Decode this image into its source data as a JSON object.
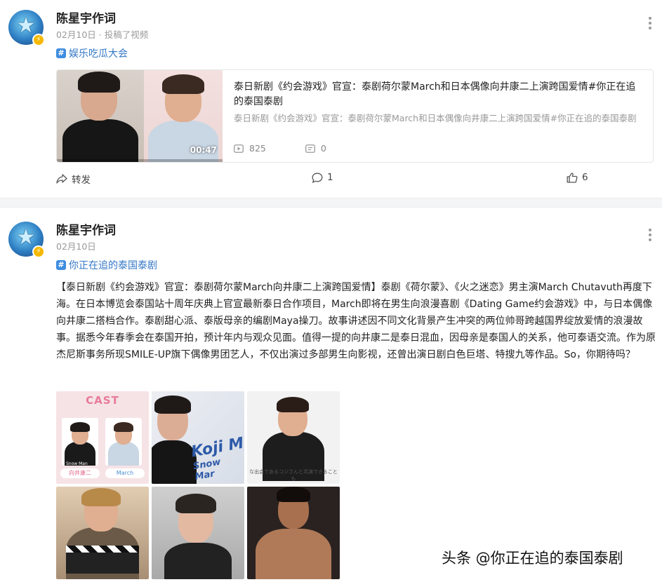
{
  "post1": {
    "author": "陈星宇作词",
    "date": "02月10日",
    "action": "投稿了视频",
    "topic": "娱乐吃瓜大会",
    "card": {
      "title": "泰日新剧《约会游戏》官宣：泰剧荷尔蒙March和日本偶像向井康二上演跨国爱情#你正在追的泰国泰剧",
      "description": "泰日新剧《约会游戏》官宣：泰剧荷尔蒙March和日本偶像向井康二上演跨国爱情#你正在追的泰国泰剧",
      "duration": "00:47",
      "views": "825",
      "comments": "0"
    },
    "actions": {
      "share": "转发",
      "comment_count": "1",
      "like_count": "6"
    }
  },
  "post2": {
    "author": "陈星宇作词",
    "date": "02月10日",
    "topic": "你正在追的泰国泰剧",
    "text": "【泰日新剧《约会游戏》官宣：泰剧荷尔蒙March向井康二上演跨国爱情】泰剧《荷尔蒙》、《火之迷恋》男主演March Chutavuth再度下海。在日本博览会泰国站十周年庆典上官宣最新泰日合作项目，March即将在男生向浪漫喜剧《Dating Game约会游戏》中，与日本偶像向井康二搭档合作。泰剧甜心派、泰版母亲的编剧Maya操刀。故事讲述因不同文化背景产生冲突的两位帅哥跨越国界绽放爱情的浪漫故事。据悉今年春季会在泰国开拍，预计年内与观众见面。值得一提的向井康二是泰日混血，因母亲是泰国人的关系，他可泰语交流。作为原杰尼斯事务所现SMILE-UP旗下偶像男团艺人，不仅出演过多部男生向影视，还曾出演日剧白色巨塔、特搜九等作品。So，你期待吗？",
    "images": {
      "cast_title": "CAST",
      "cast_left_name": "向井康二",
      "cast_left_tag": "Snow Man",
      "cast_right_name": "March",
      "koji_text": "Koji M",
      "snowman_text": "Snow Mar",
      "subtitle_jp": "な出会であるコジさんと共演できることも"
    }
  },
  "watermark": "头条 @你正在追的泰国泰剧",
  "colors": {
    "link": "#3377c6",
    "topic_icon": "#3e8de0",
    "muted": "#999999",
    "badge": "#f5b800"
  },
  "icons": [
    "more-icon",
    "hashtag-icon",
    "play-icon",
    "comment-icon",
    "share-icon",
    "like-icon",
    "lightning-badge-icon"
  ]
}
